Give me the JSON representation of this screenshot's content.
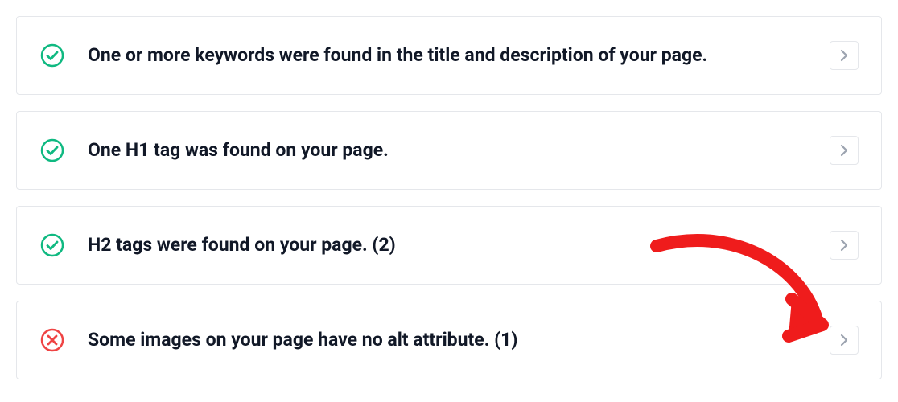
{
  "checks": [
    {
      "status": "pass",
      "message": "One or more keywords were found in the title and description of your page."
    },
    {
      "status": "pass",
      "message": "One H1 tag was found on your page."
    },
    {
      "status": "pass",
      "message": "H2 tags were found on your page. (2)"
    },
    {
      "status": "fail",
      "message": "Some images on your page have no alt attribute. (1)"
    }
  ],
  "colors": {
    "pass": "#10b981",
    "fail": "#ef4444",
    "annotation": "#ef1c1c"
  }
}
